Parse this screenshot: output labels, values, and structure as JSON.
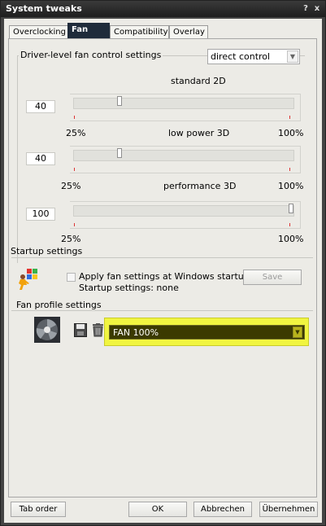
{
  "window": {
    "title": "System tweaks",
    "help_label": "?",
    "close_label": "x"
  },
  "tabs": [
    {
      "label": "Overclocking",
      "active": false
    },
    {
      "label": "Fan",
      "active": true
    },
    {
      "label": "Compatibility",
      "active": false
    },
    {
      "label": "Overlay",
      "active": false
    }
  ],
  "fan_control": {
    "group_title": "Driver-level fan control settings",
    "mode_value": "direct control",
    "sliders": [
      {
        "title": "standard 2D",
        "value": "40",
        "level_percent": 40,
        "min_label": "25%",
        "max_label": "100%"
      },
      {
        "title": "low power 3D",
        "value": "40",
        "level_percent": 40,
        "min_label": "25%",
        "max_label": "100%"
      },
      {
        "title": "performance 3D",
        "value": "100",
        "level_percent": 100,
        "min_label": "25%",
        "max_label": "100%"
      }
    ]
  },
  "startup": {
    "group_title": "Startup settings",
    "apply_checkbox_label": "Apply fan settings at Windows startup",
    "apply_checked": false,
    "status_text": "Startup settings:  none",
    "save_label": "Save"
  },
  "profile": {
    "group_title": "Fan profile settings",
    "selected_profile": "FAN 100%",
    "icons": [
      "fan-icon",
      "save-disk-icon",
      "trash-icon"
    ],
    "highlight_color": "#f1f541"
  },
  "bottom_buttons": {
    "tab_order": "Tab order",
    "ok": "OK",
    "cancel": "Abbrechen",
    "apply": "Übernehmen"
  }
}
